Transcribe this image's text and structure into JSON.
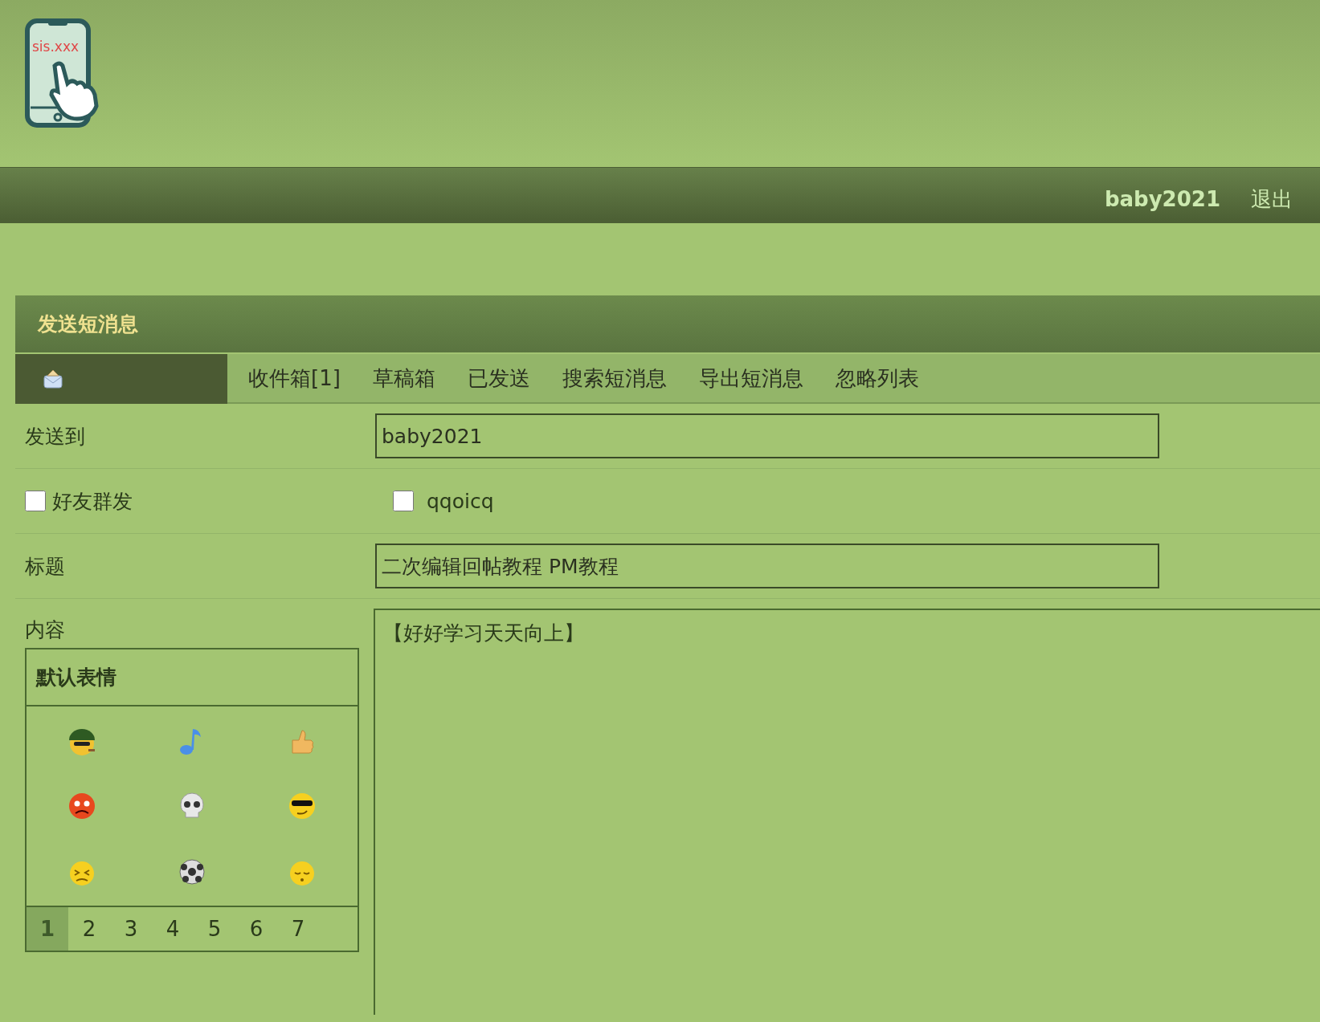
{
  "logo": {
    "text": "sis.xxx"
  },
  "user_bar": {
    "username": "baby2021",
    "logout": "退出"
  },
  "panel": {
    "title": "发送短消息"
  },
  "tabs": [
    {
      "label": "收件箱[1]"
    },
    {
      "label": "草稿箱"
    },
    {
      "label": "已发送"
    },
    {
      "label": "搜索短消息"
    },
    {
      "label": "导出短消息"
    },
    {
      "label": "忽略列表"
    }
  ],
  "form": {
    "to_label": "发送到",
    "to_value": "baby2021",
    "friends_checkbox": {
      "label": "好友群发",
      "checked": false
    },
    "qqoicq_checkbox": {
      "label": "qqoicq",
      "checked": false
    },
    "subject_label": "标题",
    "subject_value": "二次编辑回帖教程 PM教程",
    "content_label": "内容",
    "content_value": "【好好学习天天向上】"
  },
  "smilies": {
    "title": "默认表情",
    "pages": [
      {
        "label": "1",
        "selected": true
      },
      {
        "label": "2",
        "selected": false
      },
      {
        "label": "3",
        "selected": false
      },
      {
        "label": "4",
        "selected": false
      },
      {
        "label": "5",
        "selected": false
      },
      {
        "label": "6",
        "selected": false
      },
      {
        "label": "7",
        "selected": false
      }
    ]
  }
}
